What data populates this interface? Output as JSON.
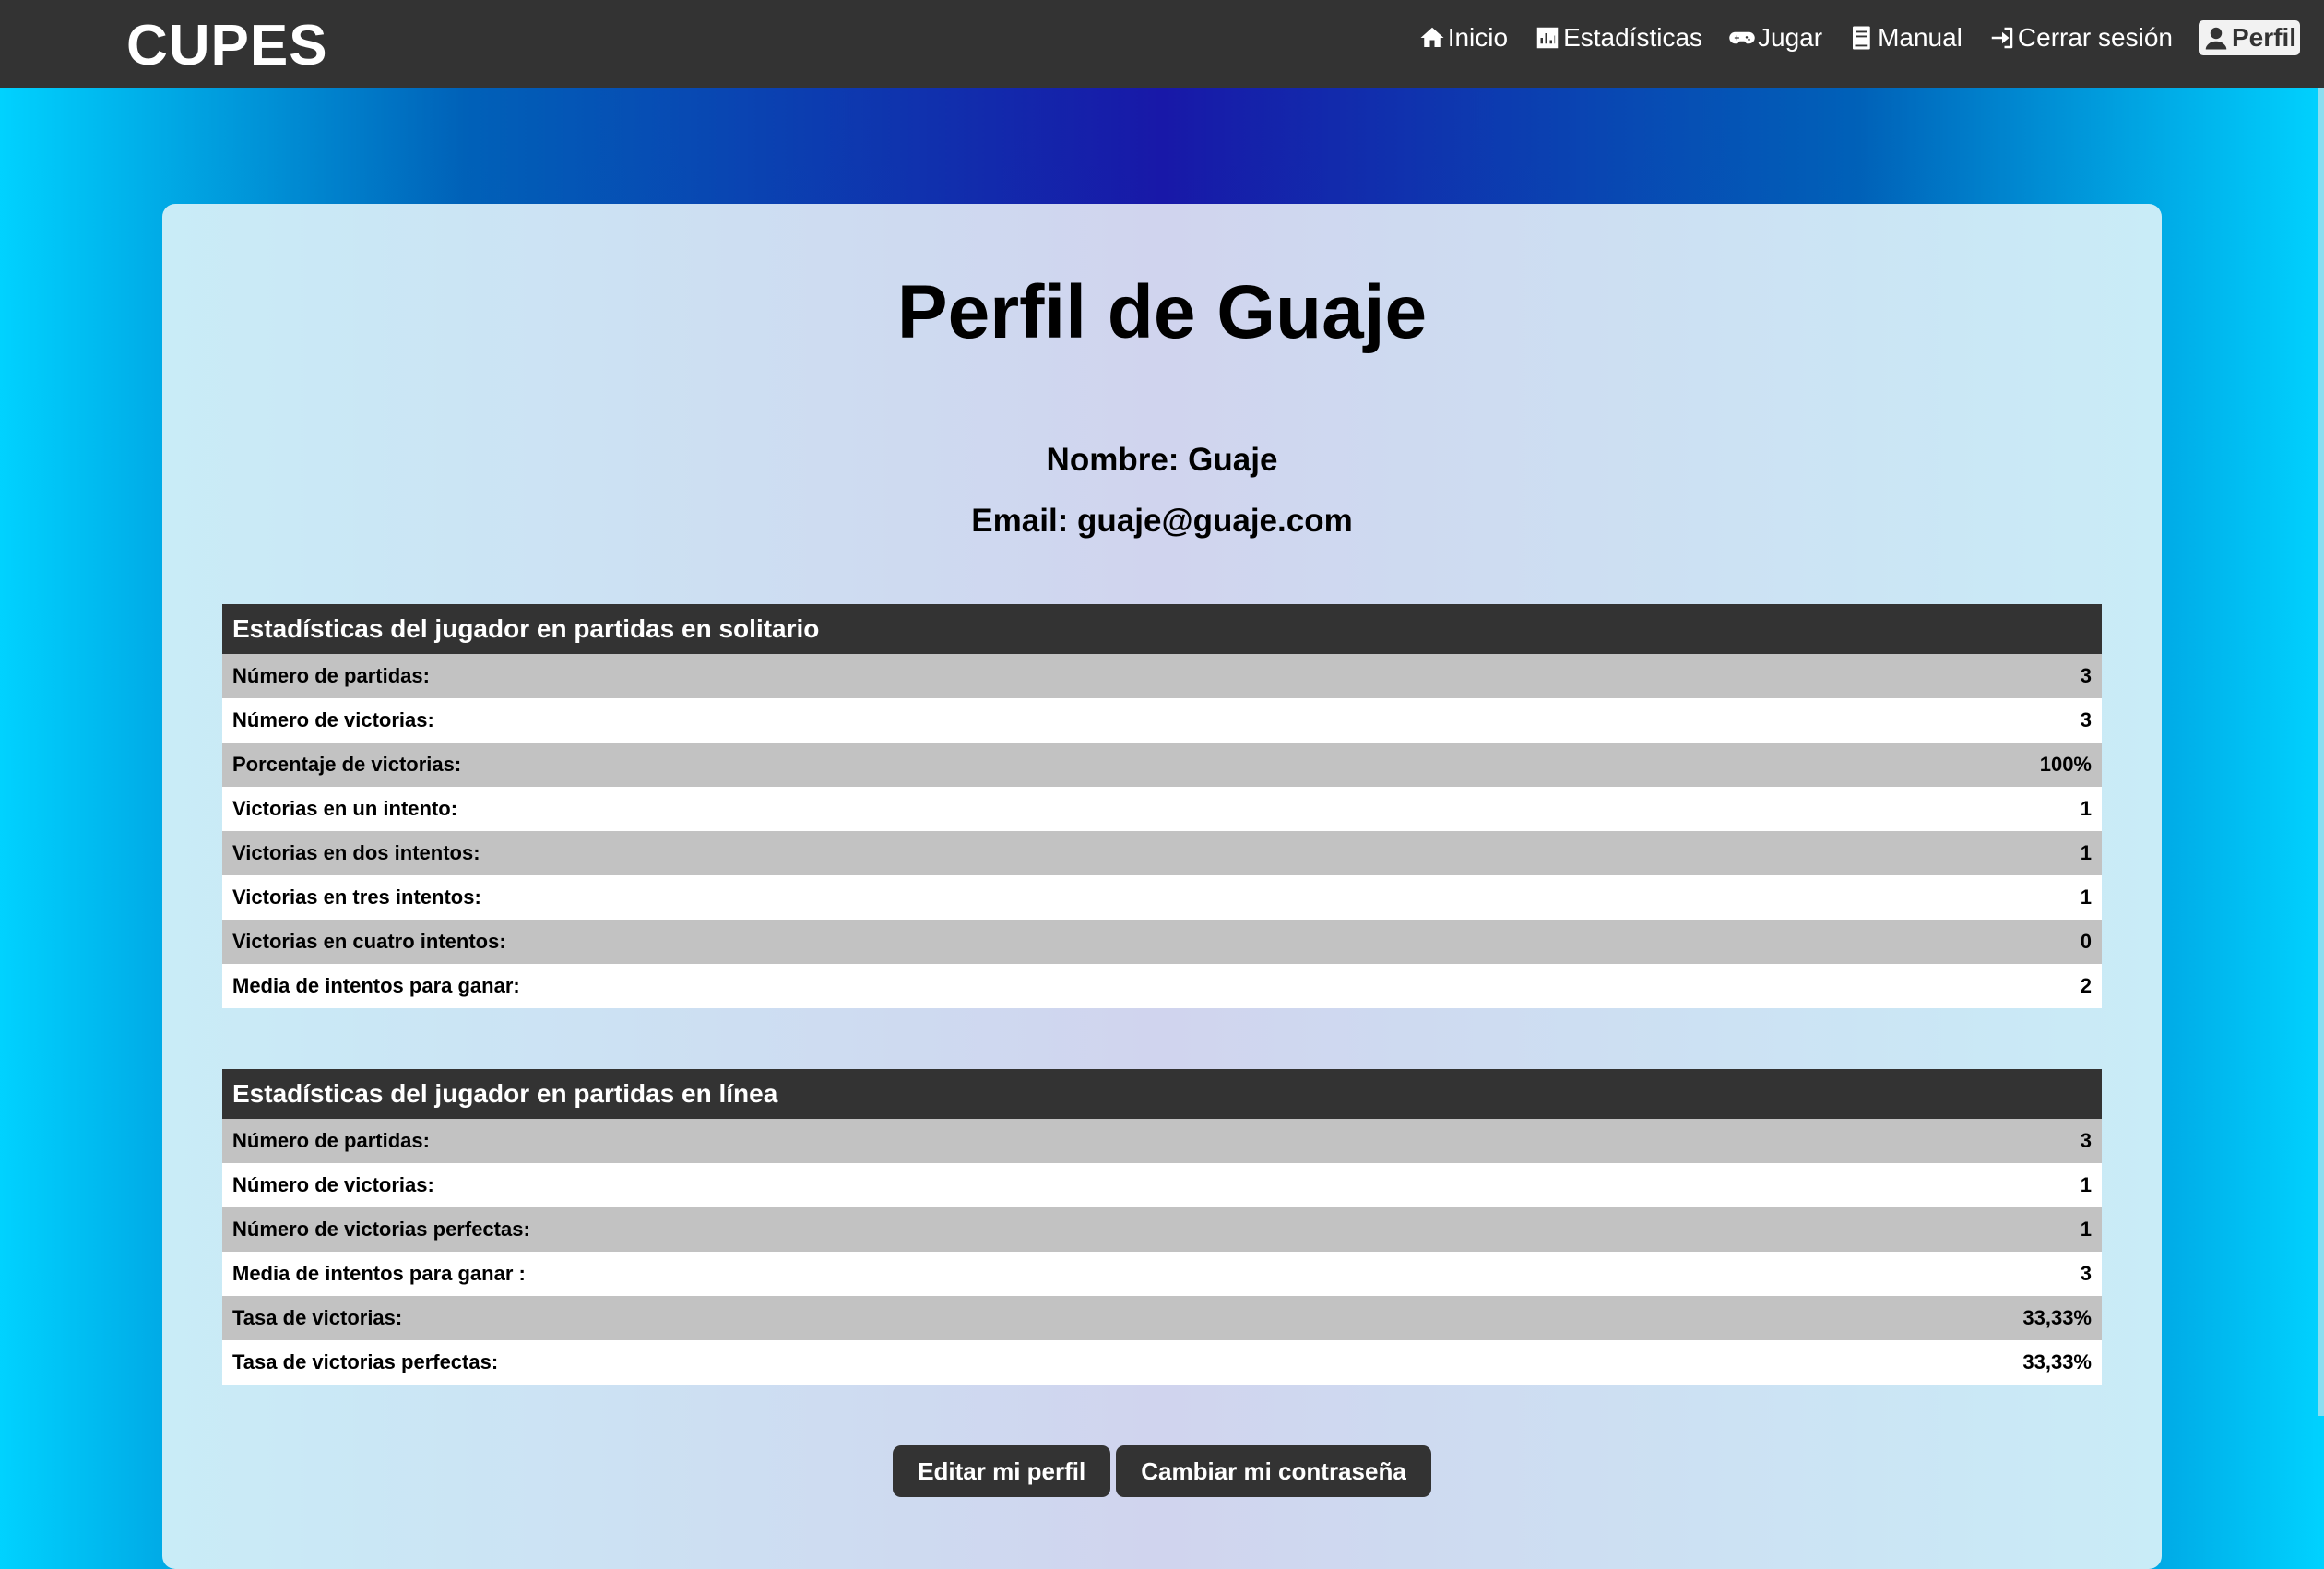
{
  "navbar": {
    "brand": "CUPES",
    "items": [
      {
        "label": "Inicio",
        "icon": "home-icon"
      },
      {
        "label": "Estadísticas",
        "icon": "chart-icon"
      },
      {
        "label": "Jugar",
        "icon": "gamepad-icon"
      },
      {
        "label": "Manual",
        "icon": "book-icon"
      },
      {
        "label": "Cerrar sesión",
        "icon": "logout-icon"
      },
      {
        "label": "Perfil",
        "icon": "user-icon"
      }
    ]
  },
  "profile": {
    "title": "Perfil de Guaje",
    "name_line": "Nombre: Guaje",
    "email_line": "Email: guaje@guaje.com"
  },
  "solo_stats": {
    "heading": "Estadísticas del jugador en partidas en solitario",
    "rows": [
      {
        "label": "Número de partidas:",
        "value": "3"
      },
      {
        "label": "Número de victorias:",
        "value": "3"
      },
      {
        "label": "Porcentaje de victorias:",
        "value": "100%"
      },
      {
        "label": "Victorias en un intento:",
        "value": "1"
      },
      {
        "label": "Victorias en dos intentos:",
        "value": "1"
      },
      {
        "label": "Victorias en tres intentos:",
        "value": "1"
      },
      {
        "label": "Victorias en cuatro intentos:",
        "value": "0"
      },
      {
        "label": "Media de intentos para ganar:",
        "value": "2"
      }
    ]
  },
  "online_stats": {
    "heading": "Estadísticas del jugador en partidas en línea",
    "rows": [
      {
        "label": "Número de partidas:",
        "value": "3"
      },
      {
        "label": "Número de victorias:",
        "value": "1"
      },
      {
        "label": "Número de victorias perfectas:",
        "value": "1"
      },
      {
        "label": "Media de intentos para ganar :",
        "value": "3"
      },
      {
        "label": "Tasa de victorias:",
        "value": "33,33%"
      },
      {
        "label": "Tasa de victorias perfectas:",
        "value": "33,33%"
      }
    ]
  },
  "actions": {
    "edit_label": "Editar mi perfil",
    "password_label": "Cambiar mi contraseña"
  },
  "colors": {
    "navbar": "#333333",
    "table_header": "#333333",
    "row_odd": "#c2c2c2",
    "row_even": "#ffffff",
    "gradient_edge": "#00d2ff",
    "gradient_center": "#1818a8"
  }
}
